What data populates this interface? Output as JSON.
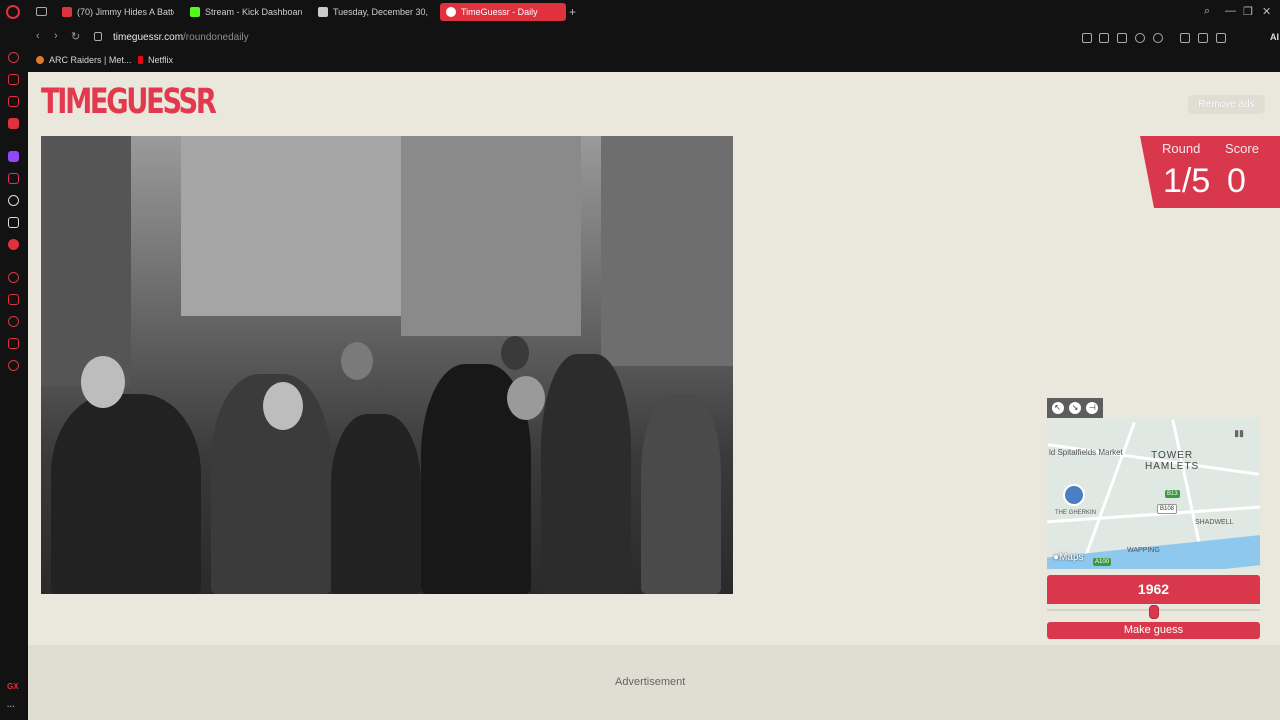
{
  "browser": {
    "tabs": [
      {
        "title": "(70) Jimmy Hides A Batte",
        "color": "#e0313f"
      },
      {
        "title": "Stream - Kick Dashboard",
        "color": "#53fc18"
      },
      {
        "title": "Tuesday, December 30, 2",
        "color": "#cccccc"
      },
      {
        "title": "TimeGuessr - Daily",
        "color": "#ffffff"
      }
    ],
    "url_domain": "timeguessr.com",
    "url_path": "/roundonedaily",
    "ai_label": "AI",
    "bookmarks": [
      {
        "label": "ARC Raiders | Met...",
        "color": "#e07b2a"
      },
      {
        "label": "Netflix",
        "color": "#e50914"
      }
    ],
    "sidebar_gx": "GX"
  },
  "page": {
    "logo": "TIMEGUESSR",
    "remove_ads": "Remove ads",
    "round_label": "Round",
    "round_value": "1/5",
    "score_label": "Score",
    "score_value": "0",
    "map": {
      "district": "TOWER\nHAMLETS",
      "labels": [
        "ld Spitalfields Market",
        "THE GHERKIN",
        "SHADWELL",
        "WAPPING"
      ],
      "routes": [
        "B13",
        "B108",
        "A100"
      ],
      "brand": "Maps"
    },
    "year": "1962",
    "year_fraction": 0.5,
    "guess_button": "Make guess",
    "advertisement": "Advertisement"
  }
}
